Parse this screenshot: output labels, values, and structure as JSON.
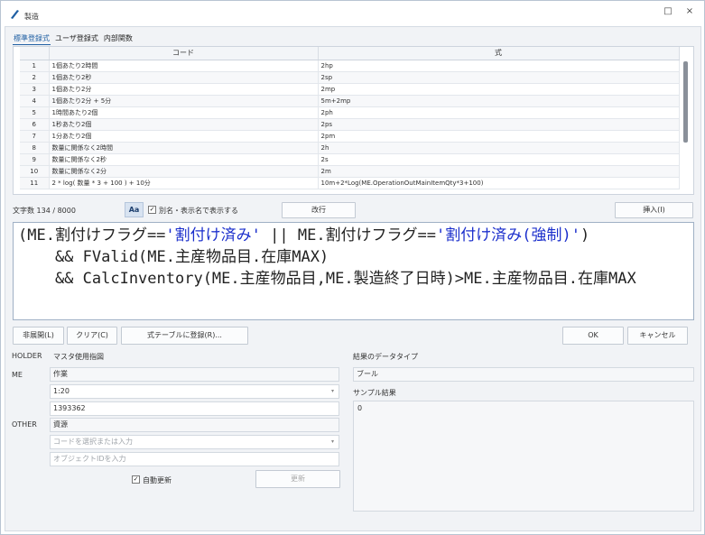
{
  "window": {
    "title": "製造",
    "icon": "pen-icon",
    "maximize_icon": "□",
    "close_icon": "×"
  },
  "tabs": [
    "標準登録式",
    "ユーザ登録式",
    "内部関数"
  ],
  "table": {
    "columns": [
      "",
      "コード",
      "式"
    ],
    "rows": [
      [
        "1",
        "1個あたり2時間",
        "2hp"
      ],
      [
        "2",
        "1個あたり2秒",
        "2sp"
      ],
      [
        "3",
        "1個あたり2分",
        "2mp"
      ],
      [
        "4",
        "1個あたり2分 + 5分",
        "5m+2mp"
      ],
      [
        "5",
        "1時間あたり2個",
        "2ph"
      ],
      [
        "6",
        "1秒あたり2個",
        "2ps"
      ],
      [
        "7",
        "1分あたり2個",
        "2pm"
      ],
      [
        "8",
        "数量に関係なく2時間",
        "2h"
      ],
      [
        "9",
        "数量に関係なく2秒",
        "2s"
      ],
      [
        "10",
        "数量に関係なく2分",
        "2m"
      ],
      [
        "11",
        "2 * log( 数量 * 3 + 100 ) + 10分",
        "10m+2*Log(ME.OperationOutMainItemQty*3+100)"
      ]
    ]
  },
  "toolbar": {
    "char_count": "文字数 134 / 8000",
    "aa_label": "Aa",
    "alias_checkbox_label": "別名・表示名で表示する",
    "alias_checked": "✓",
    "newline_button": "改行",
    "insert_button": "挿入(I)"
  },
  "editor": {
    "l1a": "(ME.割付けフラグ==",
    "l1b": "'割付け済み'",
    "l1c": " || ME.割付けフラグ==",
    "l1d": "'割付け済み(強制)'",
    "l1e": ")",
    "l2": "    && FValid(ME.主産物品目.在庫MAX)",
    "l3": "    && CalcInventory(ME.主産物品目,ME.製造終了日時)>ME.主産物品目.在庫MAX"
  },
  "buttons": {
    "collapse": "非展開(L)",
    "clear": "クリア(C)",
    "register": "式テーブルに登録(R)...",
    "ok": "OK",
    "cancel": "キャンセル"
  },
  "params": {
    "holder_label": "HOLDER",
    "holder_value": "マスタ使用指図",
    "me_label": "ME",
    "me_value": "作業",
    "me_select": "1:20",
    "me_id": "1393362",
    "other_label": "OTHER",
    "other_value": "資源",
    "other_select_placeholder": "コードを選択または入力",
    "other_id_placeholder": "オブジェクトIDを入力",
    "auto_update_label": "自動更新",
    "auto_update_checked": "✓",
    "update_button": "更新",
    "dropdown_arrow": "▾"
  },
  "result": {
    "datatype_label": "結果のデータタイプ",
    "datatype_value": "ブール",
    "sample_label": "サンプル結果",
    "sample_value": "0"
  },
  "colors": {
    "accent": "#1f5fa3",
    "string_literal": "#1b2fcc"
  }
}
